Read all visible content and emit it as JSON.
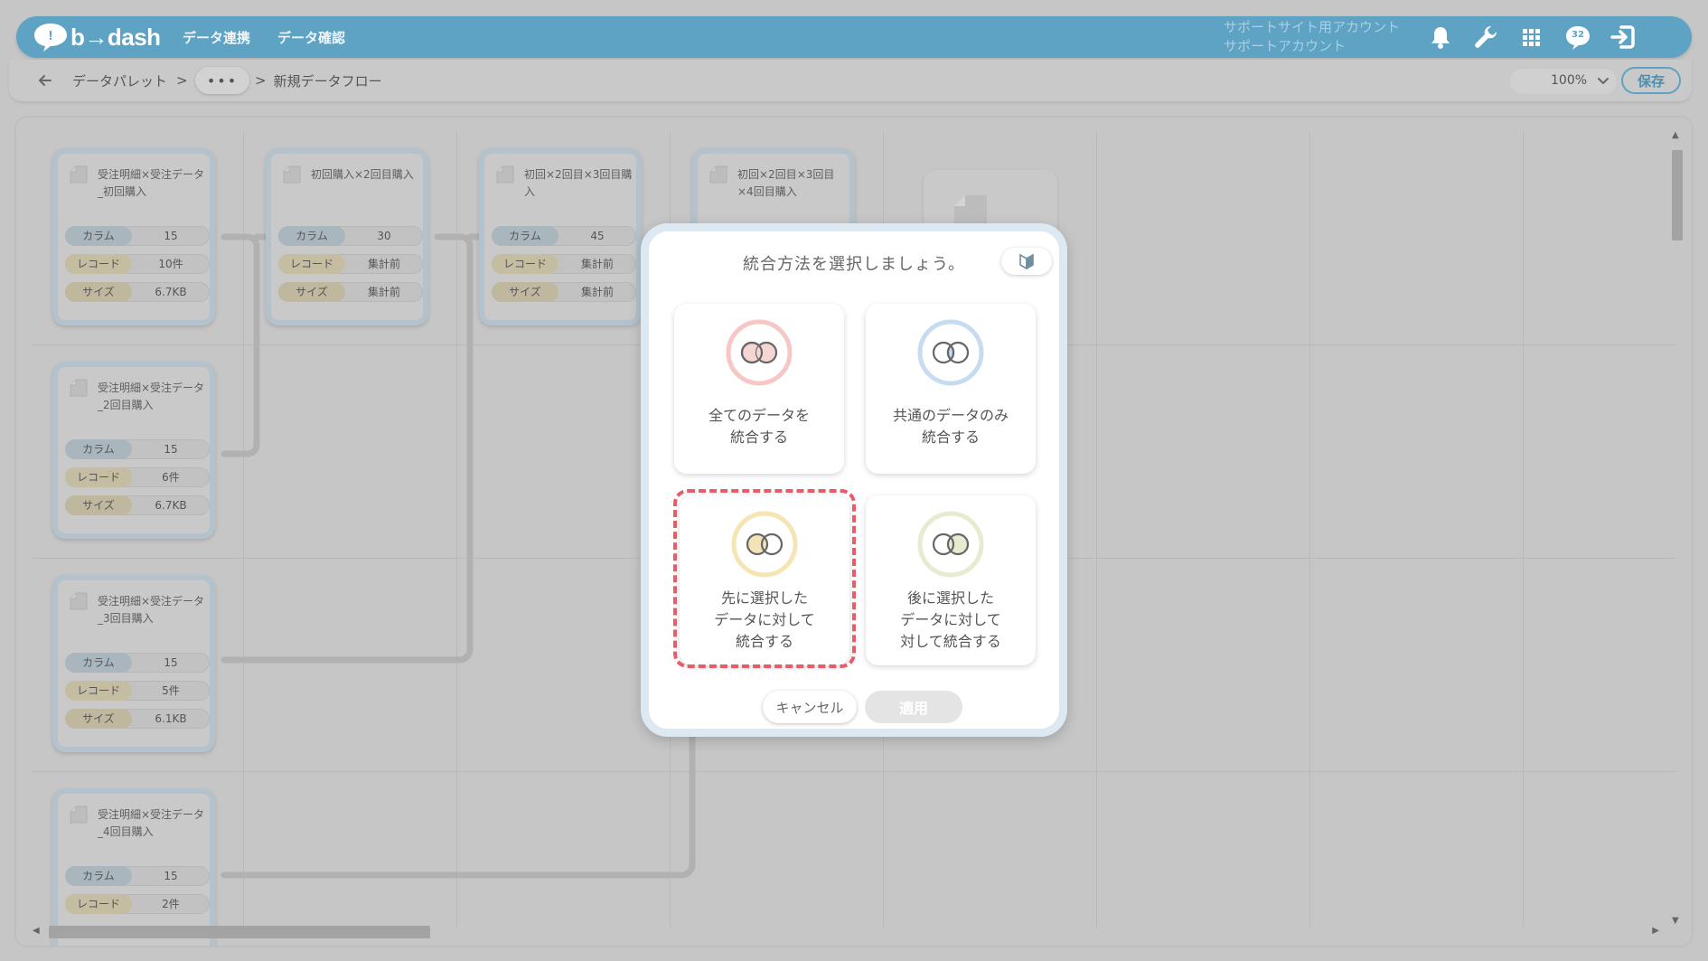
{
  "header": {
    "logo_text": "b→dash",
    "nav": [
      "データ連携",
      "データ確認"
    ],
    "account_line1": "サポートサイト用アカウント",
    "account_line2": "サポートアカウント",
    "notification_count": "32"
  },
  "toolbar": {
    "breadcrumb_root": "データパレット",
    "separator": ">",
    "more_label": "•••",
    "current_page": "新規データフロー",
    "zoom": "100%",
    "save_label": "保存"
  },
  "labels": {
    "column": "カラム",
    "record": "レコード",
    "size": "サイズ"
  },
  "nodes": [
    {
      "title": "受注明細×受注データ_初回購入",
      "columns": "15",
      "records": "10件",
      "size": "6.7KB"
    },
    {
      "title": "初回購入×2回目購入",
      "columns": "30",
      "records": "集計前",
      "size": "集計前"
    },
    {
      "title": "初回×2回目×3回目購入",
      "columns": "45",
      "records": "集計前",
      "size": "集計前"
    },
    {
      "title": "初回×2回目×3回目×4回目購入"
    },
    {
      "title": "受注明細×受注データ_2回目購入",
      "columns": "15",
      "records": "6件",
      "size": "6.7KB"
    },
    {
      "title": "受注明細×受注データ_3回目購入",
      "columns": "15",
      "records": "5件",
      "size": "6.1KB"
    },
    {
      "title": "受注明細×受注データ_4回目購入",
      "columns": "15",
      "records": "2件"
    }
  ],
  "modal": {
    "title": "統合方法を選択しましょう。",
    "options": [
      {
        "line1": "全てのデータを",
        "line2": "統合する"
      },
      {
        "line1": "共通のデータのみ",
        "line2": "統合する"
      },
      {
        "line1": "先に選択した",
        "line2": "データに対して",
        "line3": "統合する"
      },
      {
        "line1": "後に選択した",
        "line2": "データに対して",
        "line3": "対して統合する"
      }
    ],
    "cancel_label": "キャンセル",
    "apply_label": "適用"
  },
  "colors": {
    "brand": "#5ea2c4",
    "highlight": "#e85c6a",
    "ring_all": "#f6c7c4",
    "ring_common": "#c7dcf0",
    "ring_first": "#f5e5b3",
    "ring_last": "#e8ebcf"
  }
}
